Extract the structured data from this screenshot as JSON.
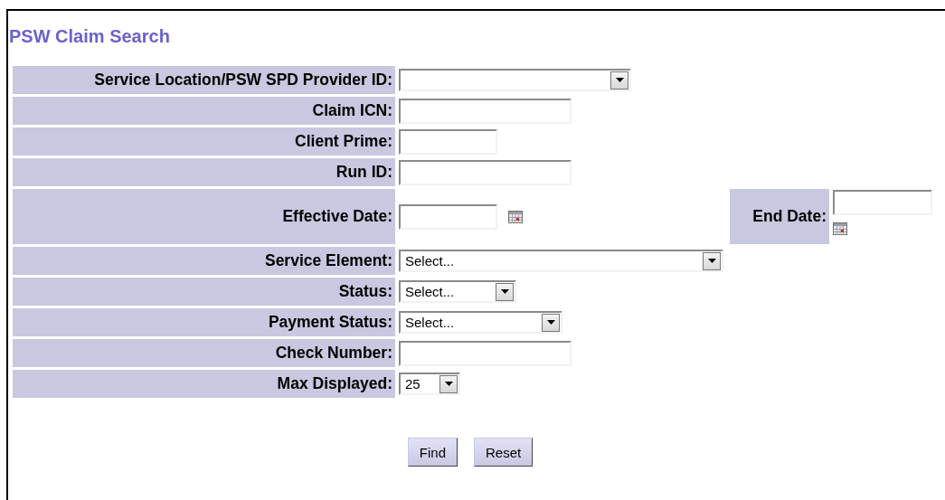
{
  "title": "PSW Claim Search",
  "fields": [
    {
      "label": "Service Location/PSW SPD Provider ID:",
      "kind": "select"
    },
    {
      "label": "Claim ICN:",
      "kind": "text"
    },
    {
      "label": "Client Prime:",
      "kind": "text"
    },
    {
      "label": "Run ID:",
      "kind": "text"
    },
    {
      "label": "Effective Date:",
      "kind": "date",
      "end_label": "End Date:"
    },
    {
      "label": "Service Element:",
      "kind": "select",
      "value": "Select..."
    },
    {
      "label": "Status:",
      "kind": "select",
      "value": "Select..."
    },
    {
      "label": "Payment Status:",
      "kind": "select",
      "value": "Select..."
    },
    {
      "label": "Check Number:",
      "kind": "text"
    },
    {
      "label": "Max Displayed:",
      "kind": "select",
      "value": "25"
    }
  ],
  "buttons": [
    "Find",
    "Reset"
  ]
}
